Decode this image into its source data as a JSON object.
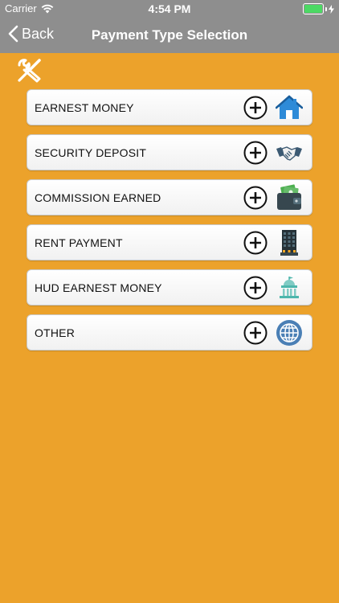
{
  "status_bar": {
    "carrier": "Carrier",
    "time": "4:54 PM",
    "battery_level": 1.0
  },
  "nav": {
    "back_label": "Back",
    "title": "Payment Type Selection"
  },
  "payment_types": [
    {
      "label": "EARNEST MONEY",
      "icon": "house-icon"
    },
    {
      "label": "SECURITY DEPOSIT",
      "icon": "handshake-icon"
    },
    {
      "label": "COMMISSION EARNED",
      "icon": "wallet-icon"
    },
    {
      "label": "RENT PAYMENT",
      "icon": "building-icon"
    },
    {
      "label": "HUD EARNEST MONEY",
      "icon": "government-building-icon"
    },
    {
      "label": "OTHER",
      "icon": "globe-icon"
    }
  ],
  "colors": {
    "background": "#ECA22B",
    "nav_bar": "#8E8E8E",
    "row_background": "#FFFFFF",
    "battery": "#4CD964"
  }
}
